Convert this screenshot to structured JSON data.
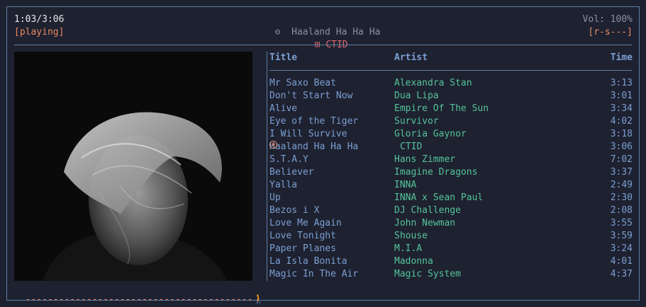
{
  "status": {
    "elapsed_total": "1:03/3:06",
    "state": "[playing]",
    "now_playing_icon": "⊖",
    "now_title": "Haaland Ha Ha Ha",
    "now_artist_icon": "⊞",
    "now_artist": "CTID",
    "volume": "Vol: 100%",
    "flags": "[r-s---]"
  },
  "progress": {
    "fraction": 0.338,
    "track": "-----------------------------------------",
    "marker_icon": "walker-icon"
  },
  "columns": {
    "title": "Title",
    "artist": "Artist",
    "time": "Time"
  },
  "playlist": [
    {
      "title": "Mr Saxo Beat",
      "artist": "Alexandra Stan",
      "time": "3:13"
    },
    {
      "title": "Don't Start Now",
      "artist": "Dua Lipa",
      "time": "3:01"
    },
    {
      "title": "Alive",
      "artist": "Empire Of The Sun",
      "time": "3:34"
    },
    {
      "title": "Eye of the Tiger",
      "artist": "Survivor",
      "time": "4:02"
    },
    {
      "title": "I Will Survive",
      "artist": "Gloria Gaynor",
      "time": "3:18"
    },
    {
      "title": "Haaland Ha Ha Ha",
      "artist": "CTID",
      "time": "3:06",
      "playing": true
    },
    {
      "title": "S.T.A.Y",
      "artist": "Hans Zimmer",
      "time": "7:02"
    },
    {
      "title": "Believer",
      "artist": "Imagine Dragons",
      "time": "3:37"
    },
    {
      "title": "Yalla",
      "artist": "INNA",
      "time": "2:49"
    },
    {
      "title": "Up",
      "artist": "INNA x Sean Paul",
      "time": "2:30"
    },
    {
      "title": "Bezos i X",
      "artist": "DJ Challenge",
      "time": "2:08"
    },
    {
      "title": "Love Me Again",
      "artist": "John Newman",
      "time": "3:55"
    },
    {
      "title": "Love Tonight",
      "artist": "Shouse",
      "time": "3:59"
    },
    {
      "title": "Paper Planes",
      "artist": "M.I.A",
      "time": "3:24"
    },
    {
      "title": "La Isla Bonita",
      "artist": "Madonna",
      "time": "4:01"
    },
    {
      "title": "Magic In The Air",
      "artist": "Magic System",
      "time": "4:37"
    }
  ],
  "colors": {
    "background": "#1e2130",
    "border": "#5f7ea6",
    "text": "#7b9fd2",
    "artist": "#55c49a",
    "accent": "#e88a62",
    "now_artist": "#e0676e"
  }
}
